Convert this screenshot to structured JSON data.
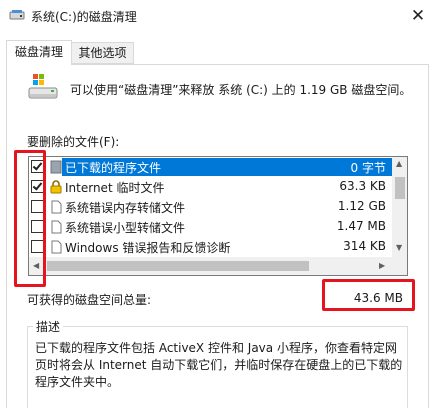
{
  "window": {
    "title": "系统(C:)的磁盘清理",
    "close_glyph": "✕"
  },
  "tabs": [
    {
      "label": "磁盘清理",
      "active": true
    },
    {
      "label": "其他选项",
      "active": false
    }
  ],
  "summary": {
    "text": "可以使用“磁盘清理”来释放 系统 (C:) 上的 1.19 GB 磁盘空间。"
  },
  "files": {
    "label": "要删除的文件(F):",
    "items": [
      {
        "name": "已下载的程序文件",
        "size": "0 字节",
        "checked": true,
        "selected": true,
        "icon": "folder-icon"
      },
      {
        "name": "Internet 临时文件",
        "size": "63.3 KB",
        "checked": true,
        "selected": false,
        "icon": "lock-icon"
      },
      {
        "name": "系统错误内存转储文件",
        "size": "1.12 GB",
        "checked": false,
        "selected": false,
        "icon": "file-icon"
      },
      {
        "name": "系统错误小型转储文件",
        "size": "1.47 MB",
        "checked": false,
        "selected": false,
        "icon": "file-icon"
      },
      {
        "name": "Windows 错误报告和反馈诊断",
        "size": "314 KB",
        "checked": false,
        "selected": false,
        "icon": "file-icon"
      }
    ]
  },
  "space": {
    "label": "可获得的磁盘空间总量:",
    "value": "43.6 MB"
  },
  "description": {
    "title": "描述",
    "text": "已下载的程序文件包括 ActiveX 控件和 Java 小程序，你查看特定网页时将会从 Internet 自动下载它们，并临时保存在硬盘上的已下载的程序文件夹中。"
  },
  "colors": {
    "highlight": "#e5141e",
    "selection": "#0078d7"
  }
}
